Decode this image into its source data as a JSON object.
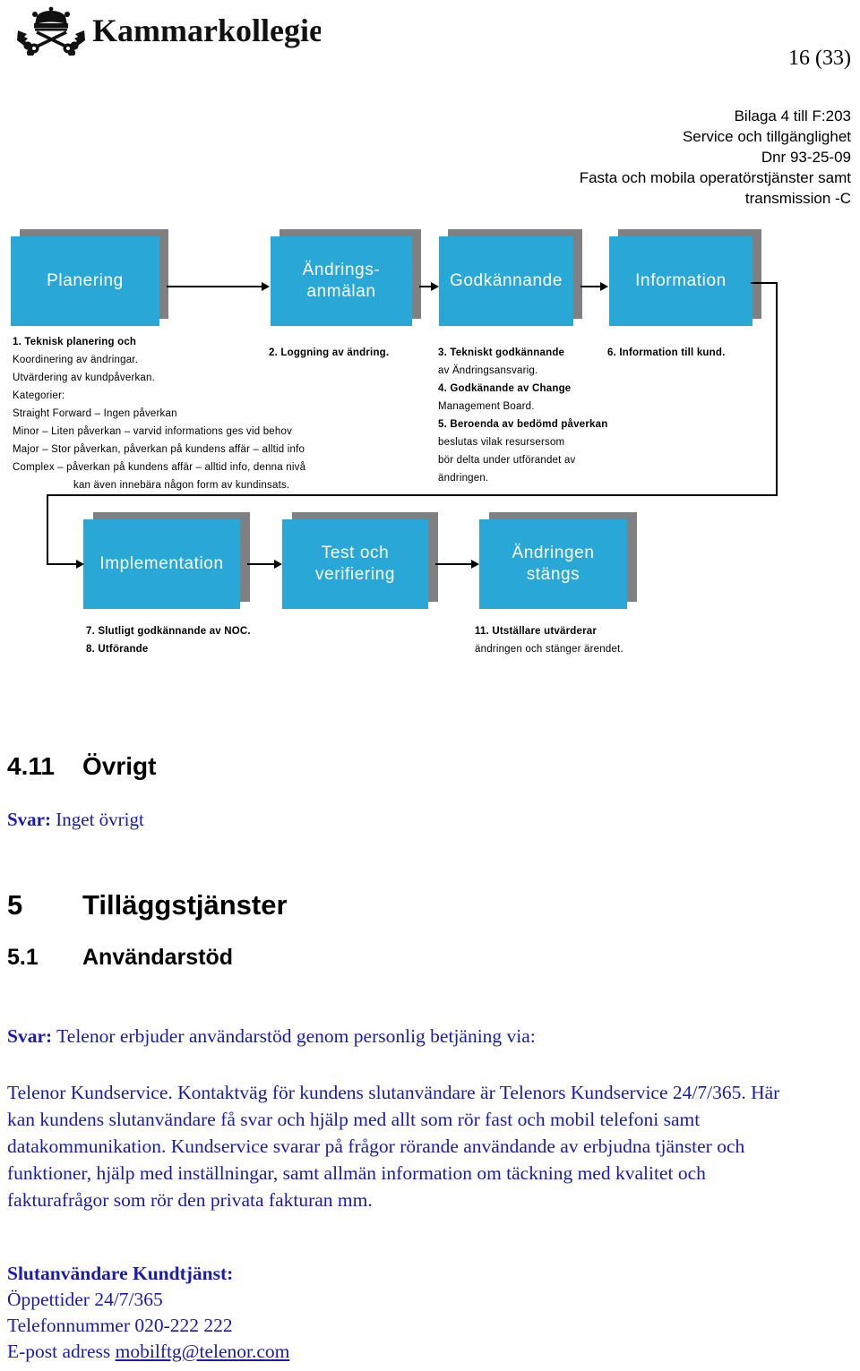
{
  "header": {
    "logo_text": "Kammarkollegiet",
    "logo_icon": "crown-crossed-keys-icon",
    "page_number": "16 (33)",
    "meta_lines": [
      "Bilaga 4 till F:203",
      "Service och tillgänglighet",
      "Dnr 93-25-09",
      "Fasta och mobila operatörstjänster samt",
      "transmission -C"
    ]
  },
  "flowchart": {
    "accent_color": "#29a8d8",
    "shadow_color": "#7f8082",
    "boxes_row1": [
      {
        "label": "Planering"
      },
      {
        "label": "Ändrings-\nanmälan"
      },
      {
        "label": "Godkännande"
      },
      {
        "label": "Information"
      }
    ],
    "boxes_row2": [
      {
        "label": "Implementation"
      },
      {
        "label": "Test och\nverifiering"
      },
      {
        "label": "Ändringen\nstängs"
      }
    ],
    "notes_col1": [
      "1. Teknisk planering och",
      "Koordinering av ändringar.",
      "Utvärdering av kundpåverkan.",
      "Kategorier:",
      "Straight Forward – Ingen påverkan",
      "Minor – Liten påverkan – varvid informations ges vid behov",
      "Major – Stor påverkan, påverkan på kundens affär – alltid info",
      "Complex – påverkan på kundens affär – alltid info, denna nivå",
      "kan även innebära någon form av kundinsats."
    ],
    "notes_col2": [
      "2. Loggning av ändring."
    ],
    "notes_col3": [
      "3. Tekniskt godkännande",
      "av Ändringsansvarig.",
      "4. Godkänande av Change",
      "Management Board.",
      "5. Beroenda av bedömd påverkan",
      "beslutas vilak resursersom",
      "bör delta under utförandet av",
      "ändringen."
    ],
    "notes_col4": [
      "6. Information till kund."
    ],
    "notes_row2_left": [
      "7. Slutligt godkännande av NOC.",
      "8. Utförande"
    ],
    "notes_row2_right": [
      "11. Utställare utvärderar",
      "ändringen och stänger ärendet."
    ]
  },
  "sections": {
    "s411_num": "4.11",
    "s411_title": "Övrigt",
    "s411_answer_label": "Svar:",
    "s411_answer_text": " Inget övrigt",
    "s5_num": "5",
    "s5_title": "Tilläggstjänster",
    "s51_num": "5.1",
    "s51_title": "Användarstöd",
    "s51_answer_label": "Svar:",
    "s51_answer_lead": " Telenor erbjuder användarstöd genom personlig betjäning via:",
    "s51_paragraph": "Telenor Kundservice. Kontaktväg för kundens slutanvändare är Telenors Kundservice 24/7/365. Här kan kundens slutanvändare få svar och hjälp med allt som rör fast och mobil telefoni samt datakommunikation. Kundservice svarar på frågor rörande användande av erbjudna tjänster och funktioner, hjälp med inställningar, samt allmän information om täckning med kvalitet och fakturafrågor som rör den privata fakturan mm."
  },
  "contact": {
    "heading": "Slutanvändare Kundtjänst:",
    "hours_line": "Öppettider 24/7/365",
    "phone_line": "Telefonnummer 020-222 222",
    "email_label": "E-post adress ",
    "email": "mobilftg@telenor.com"
  }
}
